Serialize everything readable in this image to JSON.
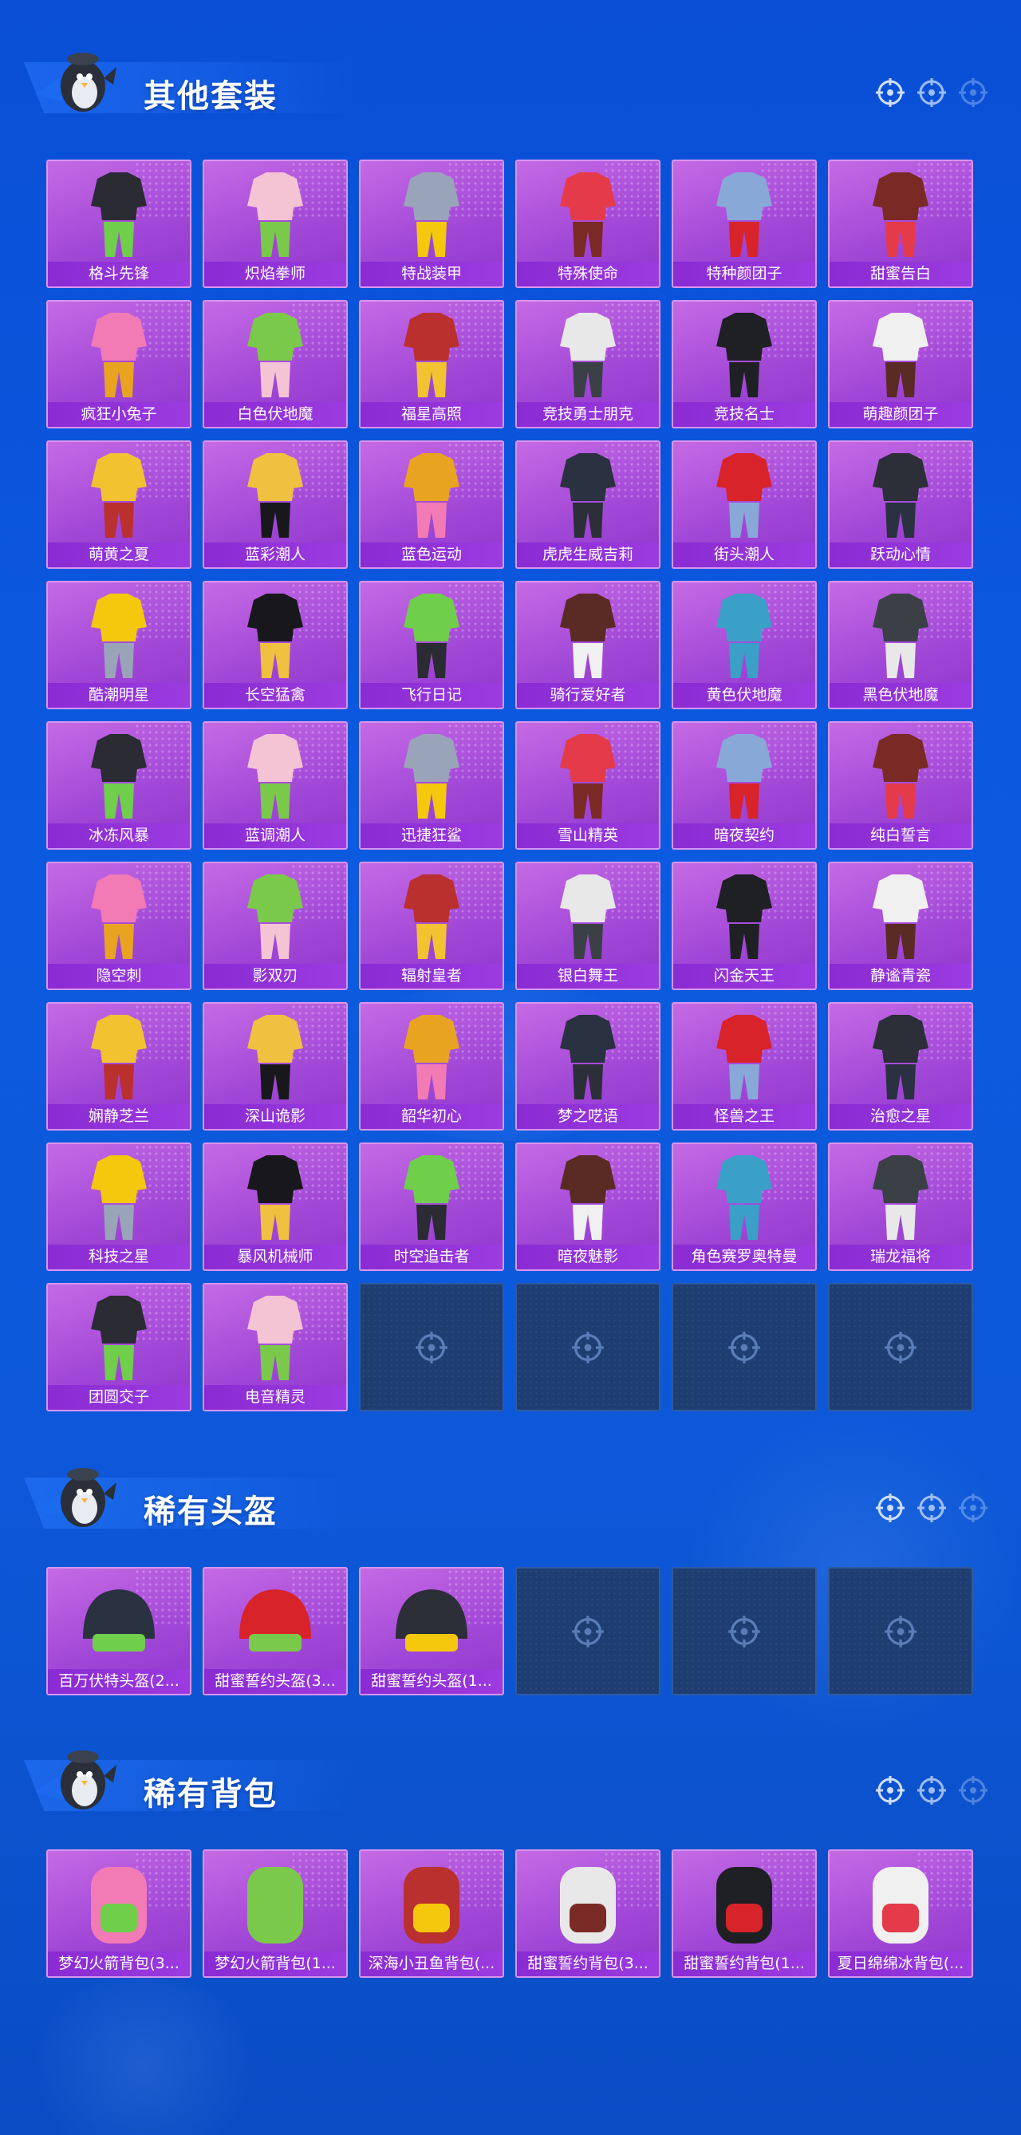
{
  "colors": {
    "page_bg": "#0b5ae0",
    "tile_bg": "#a349d8",
    "tile_label_bg": "#8a2bd3",
    "empty_tile_bg": "#1e3e72"
  },
  "sections": [
    {
      "title": "其他套装",
      "items": [
        "格斗先锋",
        "炽焰拳师",
        "特战装甲",
        "特殊使命",
        "特种颜团子",
        "甜蜜告白",
        "疯狂小兔子",
        "白色伏地魔",
        "福星高照",
        "竞技勇士朋克",
        "竞技名士",
        "萌趣颜团子",
        "萌黄之夏",
        "蓝彩潮人",
        "蓝色运动",
        "虎虎生威吉莉",
        "街头潮人",
        "跃动心情",
        "酷潮明星",
        "长空猛禽",
        "飞行日记",
        "骑行爱好者",
        "黄色伏地魔",
        "黑色伏地魔",
        "冰冻风暴",
        "蓝调潮人",
        "迅捷狂鲨",
        "雪山精英",
        "暗夜契约",
        "纯白誓言",
        "隐空刺",
        "影双刃",
        "辐射皇者",
        "银白舞王",
        "闪金天王",
        "静谧青瓷",
        "娴静芝兰",
        "深山诡影",
        "韶华初心",
        "梦之呓语",
        "怪兽之王",
        "治愈之星",
        "科技之星",
        "暴风机械师",
        "时空追击者",
        "暗夜魅影",
        "角色赛罗奥特曼",
        "瑞龙福将",
        "团圆交子",
        "电音精灵"
      ],
      "empty_slots": 4
    },
    {
      "title": "稀有头盔",
      "items": [
        "百万伏特头盔(2...",
        "甜蜜誓约头盔(3...",
        "甜蜜誓约头盔(1..."
      ],
      "empty_slots": 3
    },
    {
      "title": "稀有背包",
      "items": [
        "梦幻火箭背包(3...",
        "梦幻火箭背包(1...",
        "深海小丑鱼背包(...",
        "甜蜜誓约背包(3...",
        "甜蜜誓约背包(1...",
        "夏日绵绵冰背包(..."
      ],
      "empty_slots": 0
    }
  ],
  "icons": {
    "header_right": [
      "crosshair-icon",
      "crosshair-icon",
      "crosshair-icon"
    ],
    "empty_slot": "crosshair-icon",
    "mascot": "penguin-mascot-icon"
  }
}
